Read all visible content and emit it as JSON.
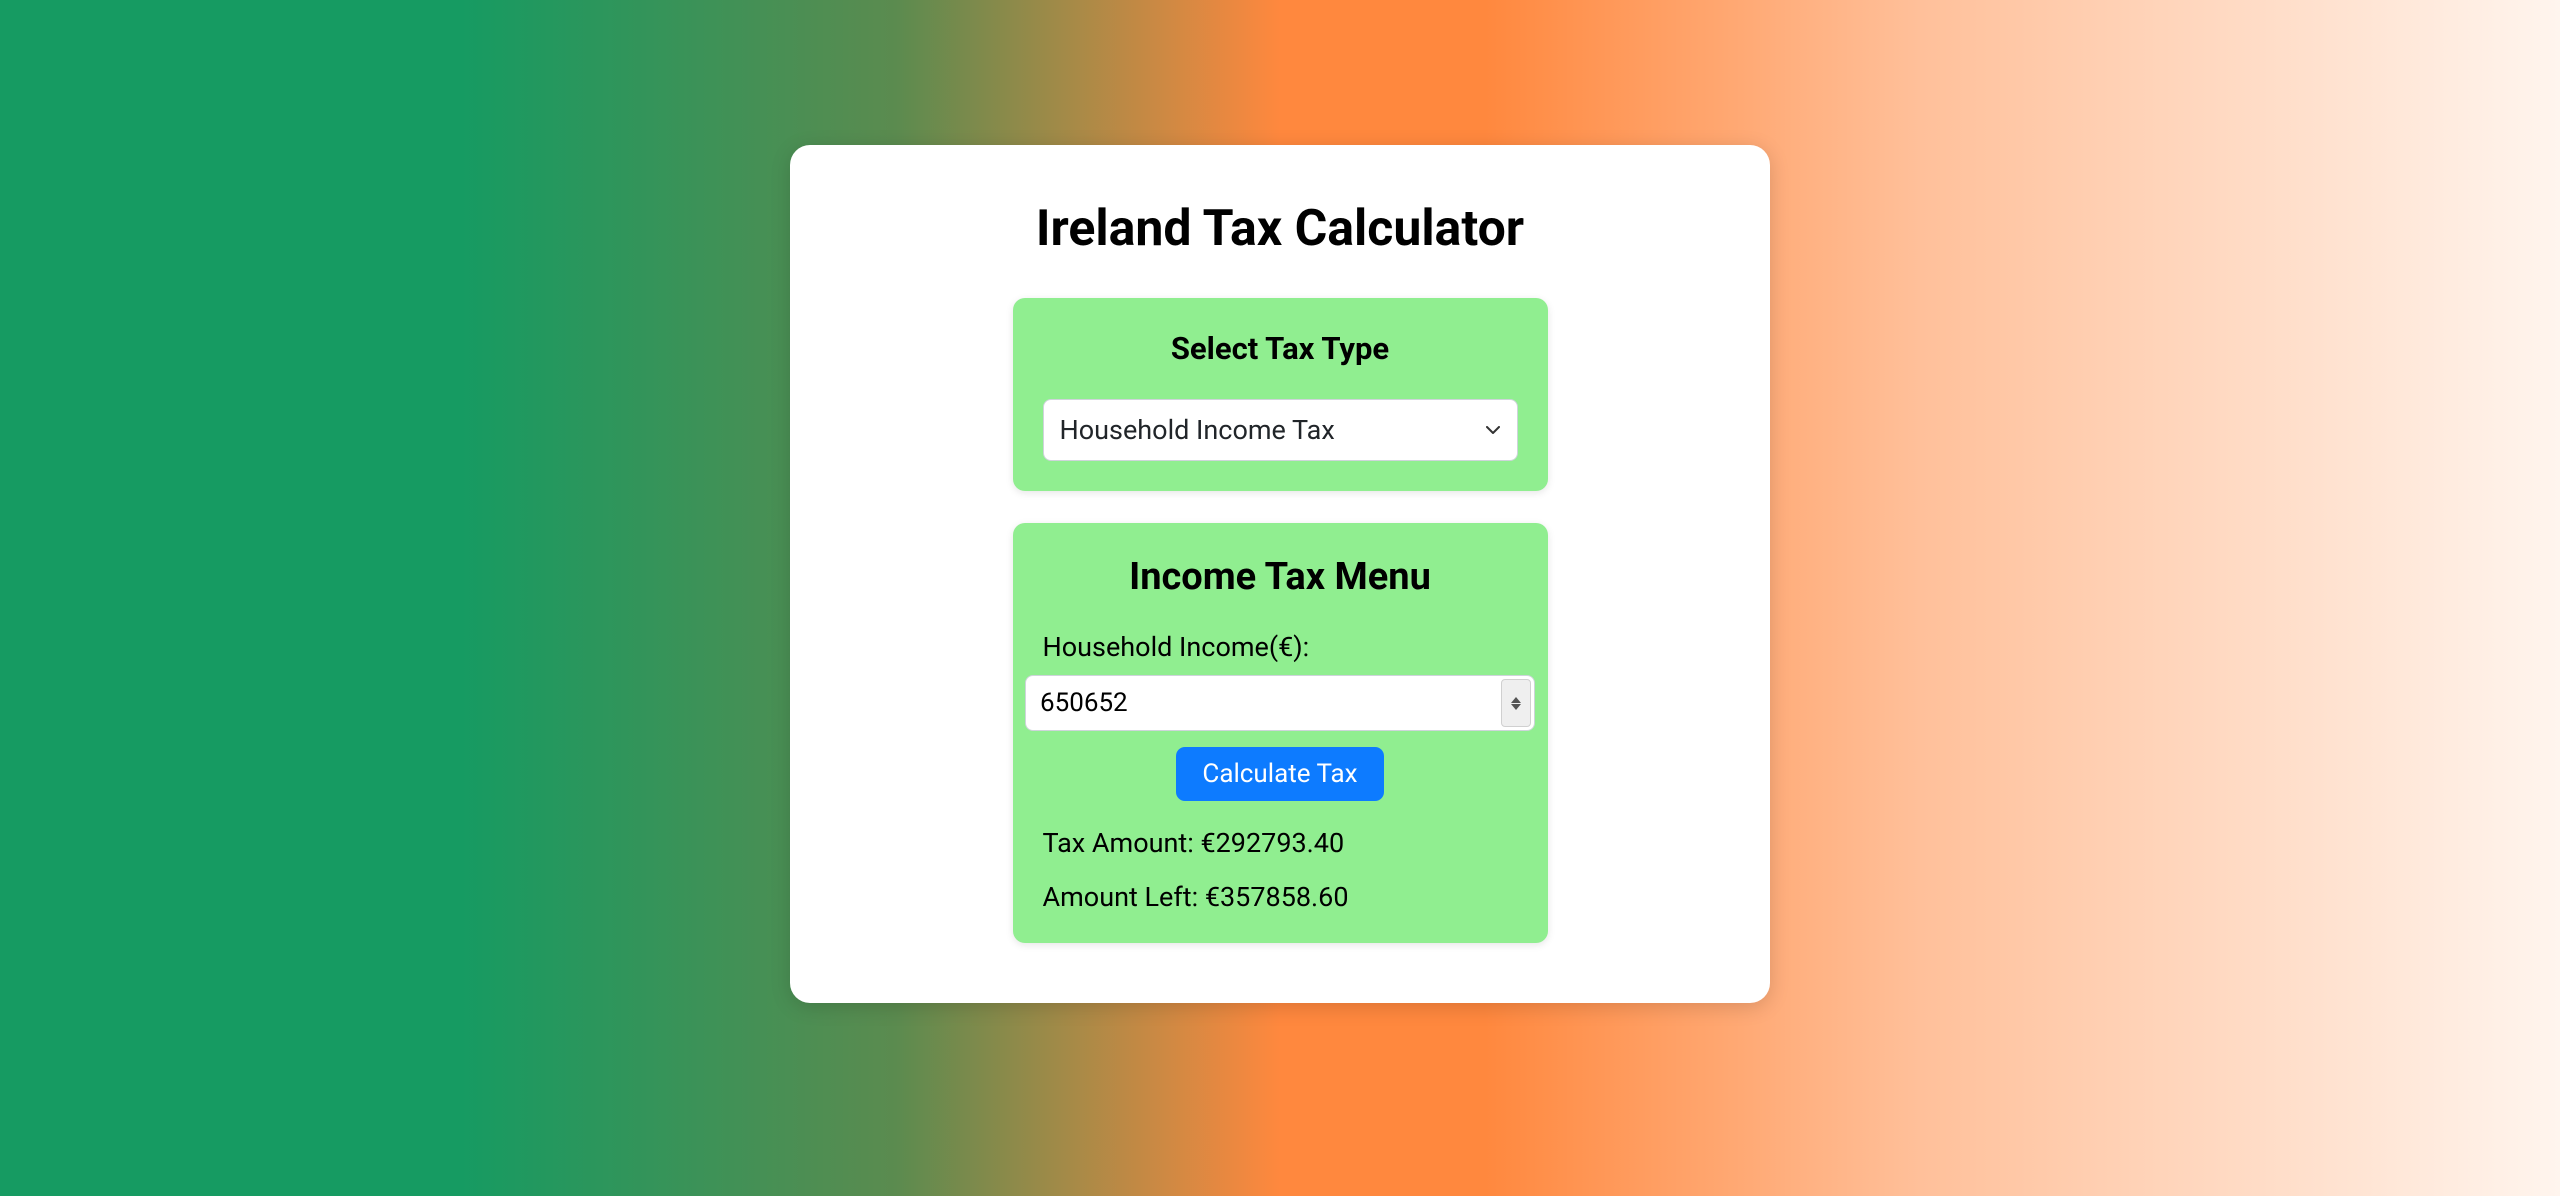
{
  "title": "Ireland Tax Calculator",
  "tax_type_panel": {
    "heading": "Select Tax Type",
    "selected": "Household Income Tax"
  },
  "income_panel": {
    "heading": "Income Tax Menu",
    "income_label": "Household Income(€):",
    "income_value": "650652",
    "calculate_label": "Calculate Tax",
    "tax_amount_line": "Tax Amount: €292793.40",
    "amount_left_line": "Amount Left: €357858.60"
  }
}
